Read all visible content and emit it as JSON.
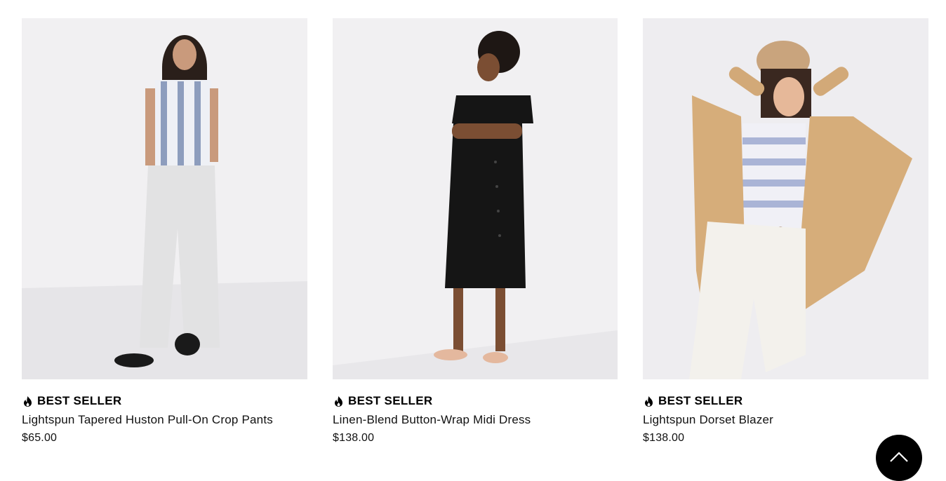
{
  "products": [
    {
      "badge": "BEST SELLER",
      "name": "Lightspun Tapered Huston Pull-On Crop Pants",
      "price": "$65.00",
      "image_icon": "model-photo"
    },
    {
      "badge": "BEST SELLER",
      "name": "Linen-Blend Button-Wrap Midi Dress",
      "price": "$138.00",
      "image_icon": "model-photo"
    },
    {
      "badge": "BEST SELLER",
      "name": "Lightspun Dorset Blazer",
      "price": "$138.00",
      "image_icon": "model-photo"
    }
  ],
  "icons": {
    "badge_icon": "flame-icon",
    "back_to_top_icon": "chevron-up-icon"
  },
  "colors": {
    "badge_text": "#000000",
    "back_to_top_bg": "#000000"
  }
}
